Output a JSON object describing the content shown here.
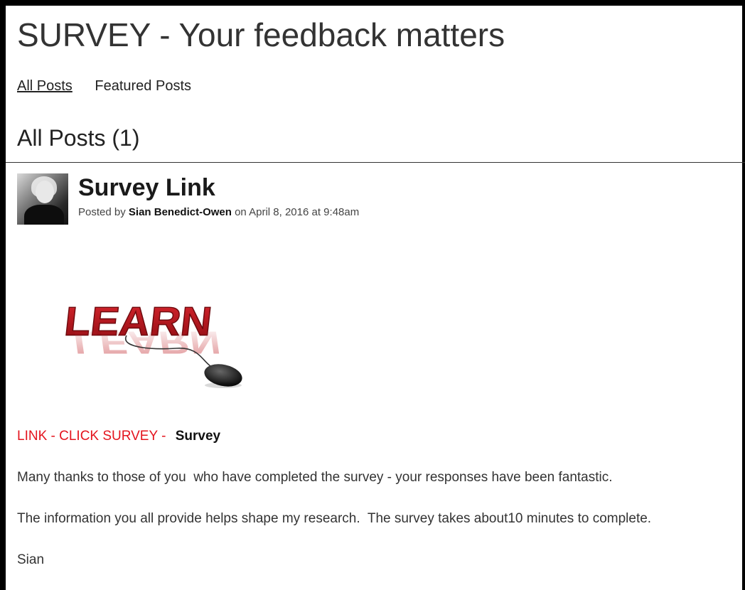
{
  "site": {
    "title": "SURVEY - Your feedback matters"
  },
  "tabs": [
    {
      "label": "All Posts",
      "active": true
    },
    {
      "label": "Featured Posts",
      "active": false
    }
  ],
  "section": {
    "title": "All Posts (1)"
  },
  "post": {
    "title": "Survey Link",
    "meta": {
      "posted_by_prefix": "Posted by ",
      "author": "Sian Benedict-Owen",
      "date_text": " on April 8, 2016 at 9:48am"
    },
    "image": {
      "text": "LEARN",
      "icon": "computer-mouse-icon"
    },
    "link_line": {
      "prefix": "LINK - CLICK SURVEY - ",
      "link": "Survey",
      "prefix_color": "#e4141e"
    },
    "paragraphs": [
      "Many thanks to those of you  who have completed the survey - your responses have been fantastic.",
      "The information you all provide helps shape my research.  The survey takes about10 minutes to complete.",
      "Sian"
    ]
  },
  "colors": {
    "learn_red": "#b5121b",
    "link_red": "#e4141e",
    "text": "#333333"
  }
}
